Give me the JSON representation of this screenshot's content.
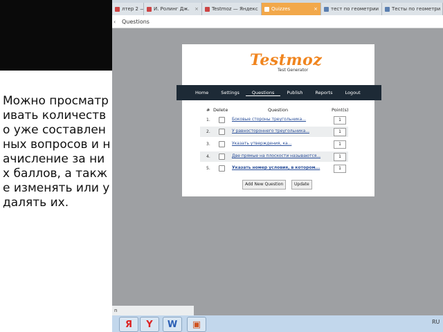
{
  "caption": "Можно просматривать количество уже составленных вопросов и начисление за них баллов,  а также изменять или удалять их.",
  "browser": {
    "tabs": [
      {
        "label": "лтер 2 — Р",
        "active": false
      },
      {
        "label": "И. Ролинг Дж.",
        "active": false
      },
      {
        "label": "Testmoz — Яндекс",
        "active": false
      },
      {
        "label": "Quizzes",
        "active": true
      },
      {
        "label": "тест по геометрии",
        "active": false
      },
      {
        "label": "Тесты по геометри",
        "active": false
      }
    ],
    "address": {
      "breadcrumb": "Questions"
    }
  },
  "testmoz": {
    "logo": "Testmoz",
    "logo_sub": "Test Generator",
    "nav": [
      "Home",
      "Settings",
      "Questions",
      "Publish",
      "Reports",
      "Logout"
    ],
    "table": {
      "headers": {
        "num": "#",
        "delete": "Delete",
        "question": "Question",
        "points": "Point(s)"
      },
      "rows": [
        {
          "num": "1.",
          "question": "Боковые стороны треугольника...",
          "points": "1"
        },
        {
          "num": "2.",
          "question": "У равностороннего треугольника...",
          "points": "1"
        },
        {
          "num": "3.",
          "question": "Указать утверждения, ка...",
          "points": "1"
        },
        {
          "num": "4.",
          "question": "Две прямые на плоскости называются...",
          "points": "1"
        },
        {
          "num": "5.",
          "question": "Указать номер условия, в котором...",
          "points": "1"
        }
      ]
    },
    "buttons": {
      "add": "Add New Question",
      "update": "Update"
    }
  },
  "status_text": "n",
  "taskbar": {
    "lang": "RU"
  },
  "colors": {
    "logo": "#f0851f",
    "nav_bg": "#1d2a36",
    "link": "#2a4f9a",
    "active_tab": "#f2a84a"
  }
}
